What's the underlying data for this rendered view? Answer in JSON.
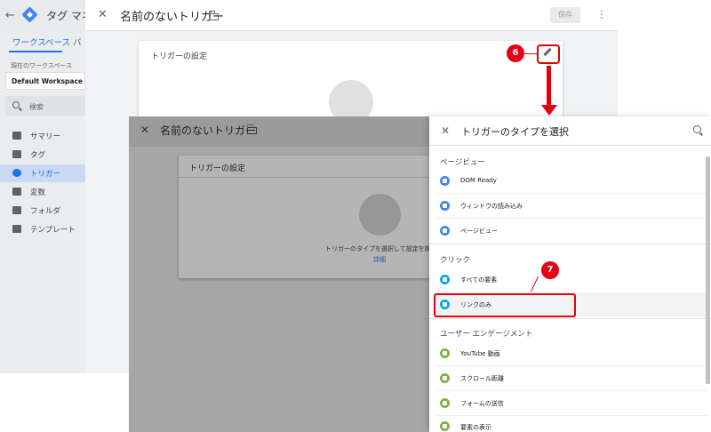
{
  "gtm": {
    "app_title": "タグ マネ",
    "workspace_tab": "ワークスペース",
    "workspace_tab_cut": "バ",
    "current_workspace_label": "現在のワークスペース",
    "workspace_name": "Default Workspace",
    "search_placeholder": "検索",
    "nav": [
      {
        "label": "サマリー",
        "icon": "folder-icon"
      },
      {
        "label": "タグ",
        "icon": "tag-icon"
      },
      {
        "label": "トリガー",
        "icon": "trigger-icon",
        "active": true
      },
      {
        "label": "変数",
        "icon": "variable-icon"
      },
      {
        "label": "フォルダ",
        "icon": "folder-icon"
      },
      {
        "label": "テンプレート",
        "icon": "template-icon"
      }
    ]
  },
  "trigger_editor": {
    "title": "名前のないトリガー",
    "save_label": "保存",
    "card_title": "トリガーの設定"
  },
  "annotations": {
    "step6": "6",
    "step7": "7",
    "accent": "#e60012"
  },
  "trigger_editor_2": {
    "title": "名前のないトリガー",
    "card_title": "トリガーの設定",
    "hint": "トリガーのタイプを選択して設定を開始",
    "link": "詳細"
  },
  "type_panel": {
    "title": "トリガーのタイプを選択",
    "sections": [
      {
        "label": "ページビュー",
        "items": [
          {
            "label": "DOM Ready",
            "icon": "dom-ready-icon",
            "color": "#4285f4"
          },
          {
            "label": "ウィンドウの読み込み",
            "icon": "window-load-icon",
            "color": "#4285f4"
          },
          {
            "label": "ページビュー",
            "icon": "eye-icon",
            "color": "#4285f4"
          }
        ]
      },
      {
        "label": "クリック",
        "items": [
          {
            "label": "すべての要素",
            "icon": "click-icon",
            "color": "#03a9f4"
          },
          {
            "label": "リンクのみ",
            "icon": "link-icon",
            "color": "#03a9f4",
            "selected": true
          }
        ]
      },
      {
        "label": "ユーザー エンゲージメント",
        "items": [
          {
            "label": "YouTube 動画",
            "icon": "play-icon",
            "color": "#7cb342"
          },
          {
            "label": "スクロール距離",
            "icon": "scroll-icon",
            "color": "#7cb342"
          },
          {
            "label": "フォームの送信",
            "icon": "form-icon",
            "color": "#7cb342"
          },
          {
            "label": "要素の表示",
            "icon": "visibility-icon",
            "color": "#7cb342"
          }
        ]
      }
    ]
  }
}
